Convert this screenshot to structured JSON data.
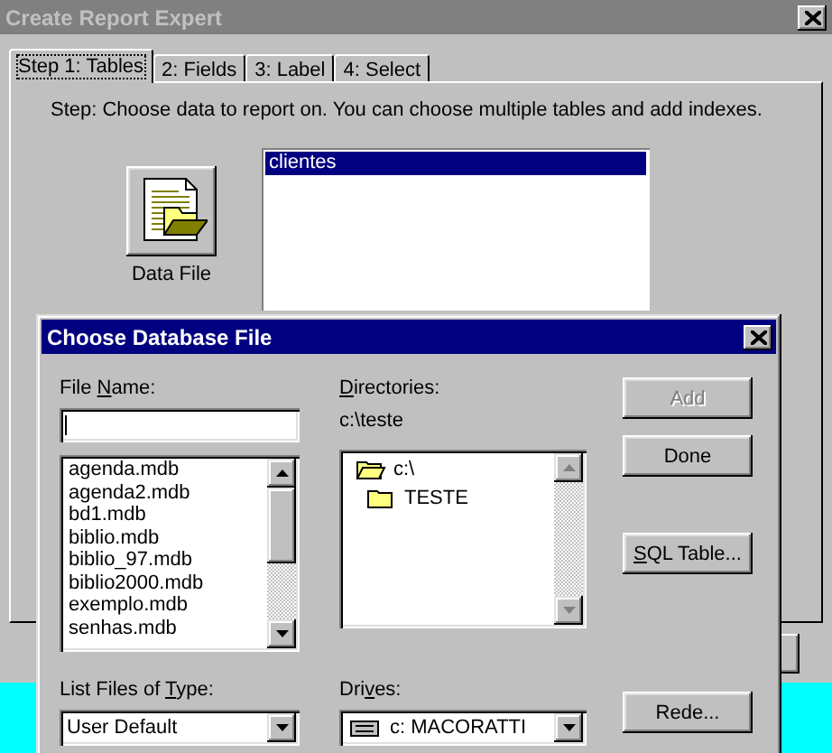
{
  "window": {
    "title": "Create Report Expert"
  },
  "tabs": [
    {
      "label": "Step 1: Tables",
      "selected": true
    },
    {
      "label": "2: Fields",
      "selected": false
    },
    {
      "label": "3: Label",
      "selected": false
    },
    {
      "label": "4: Select",
      "selected": false
    }
  ],
  "step_text": "Step: Choose data to report on. You can choose multiple tables and add indexes.",
  "data_file_button": {
    "label": "Data File"
  },
  "tables_list": {
    "items": [
      {
        "label": "clientes",
        "selected": true
      }
    ]
  },
  "dialog": {
    "title": "Choose Database File",
    "file_name": {
      "label": {
        "pre": "File ",
        "key": "N",
        "post": "ame:"
      }
    },
    "files": [
      {
        "label": "agenda.mdb"
      },
      {
        "label": "agenda2.mdb"
      },
      {
        "label": "bd1.mdb"
      },
      {
        "label": "biblio.mdb"
      },
      {
        "label": "biblio_97.mdb"
      },
      {
        "label": "biblio2000.mdb"
      },
      {
        "label": "exemplo.mdb"
      },
      {
        "label": "senhas.mdb"
      }
    ],
    "directories": {
      "label": {
        "key": "D",
        "post": "irectories:"
      },
      "path": "c:\\teste",
      "tree": [
        {
          "label": "c:\\",
          "children": [
            {
              "label": "TESTE"
            }
          ]
        }
      ]
    },
    "file_type": {
      "label": {
        "pre": "List Files of ",
        "key": "T",
        "post": "ype:"
      },
      "value": "User Default"
    },
    "drives": {
      "label": {
        "pre": "Dri",
        "key": "v",
        "post": "es:"
      },
      "value": "c: MACORATTI"
    },
    "button_groups": [
      [
        {
          "label": {
            "post": "Add"
          },
          "disabled": true
        },
        {
          "label": {
            "post": "Done"
          },
          "disabled": false
        }
      ],
      [
        {
          "label": {
            "key": "S",
            "post": "QL Table..."
          },
          "disabled": false
        }
      ],
      [
        {
          "label": {
            "post": "Rede..."
          },
          "disabled": false
        }
      ]
    ]
  }
}
